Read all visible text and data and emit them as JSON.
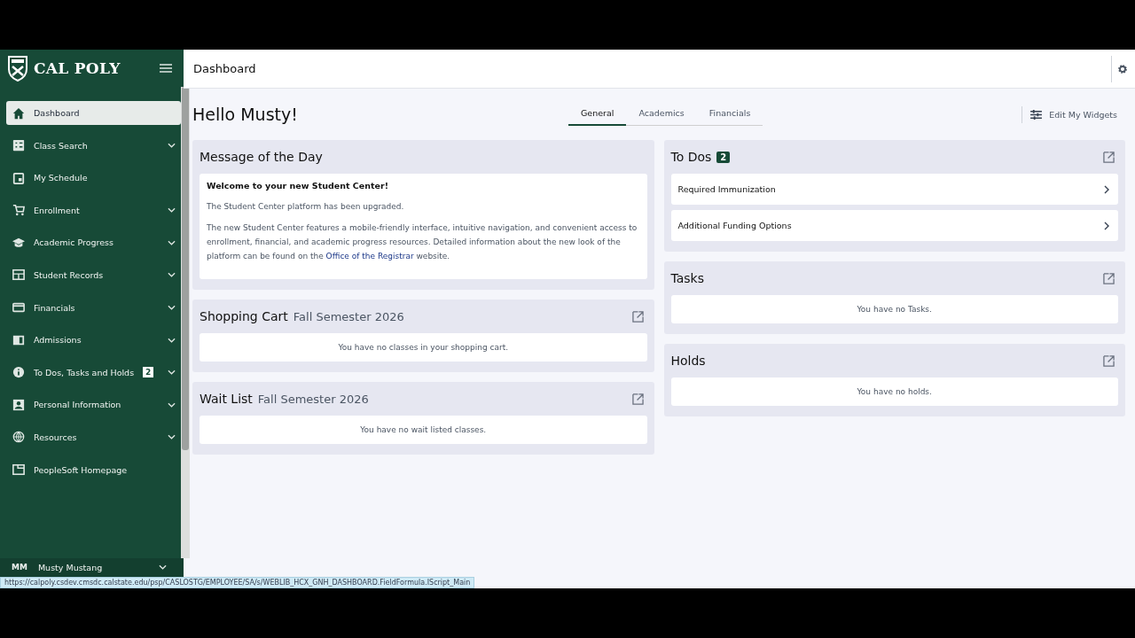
{
  "sidebar": {
    "logo": "CAL POLY",
    "items": [
      {
        "label": "Dashboard",
        "selected": true,
        "expandable": false
      },
      {
        "label": "Class Search",
        "selected": false,
        "expandable": true
      },
      {
        "label": "My Schedule",
        "selected": false,
        "expandable": false
      },
      {
        "label": "Enrollment",
        "selected": false,
        "expandable": true
      },
      {
        "label": "Academic Progress",
        "selected": false,
        "expandable": true
      },
      {
        "label": "Student Records",
        "selected": false,
        "expandable": true
      },
      {
        "label": "Financials",
        "selected": false,
        "expandable": true
      },
      {
        "label": "Admissions",
        "selected": false,
        "expandable": true
      },
      {
        "label": "To Dos, Tasks and Holds",
        "selected": false,
        "expandable": true,
        "badge": "2"
      },
      {
        "label": "Personal Information",
        "selected": false,
        "expandable": true
      },
      {
        "label": "Resources",
        "selected": false,
        "expandable": true
      },
      {
        "label": "PeopleSoft Homepage",
        "selected": false,
        "expandable": false
      }
    ],
    "user": {
      "initials": "MM",
      "name": "Musty Mustang"
    }
  },
  "header": {
    "title": "Dashboard"
  },
  "greeting": "Hello Musty!",
  "tabs": [
    {
      "label": "General",
      "selected": true
    },
    {
      "label": "Academics",
      "selected": false
    },
    {
      "label": "Financials",
      "selected": false
    }
  ],
  "edit_button": "Edit My Widgets",
  "message_of_the_day": {
    "title": "Message of the Day",
    "heading": "Welcome to your new Student Center!",
    "paragraph_1": "The Student Center platform has been upgraded.",
    "paragraph_2_before": "The new Student Center features a mobile-friendly interface, intuitive navigation, and convenient access to enrollment, financial, and academic progress resources. Detailed information about the new look of the platform can be found on the ",
    "paragraph_2_link": "Office of the Registrar",
    "paragraph_2_after": " website."
  },
  "shopping_cart": {
    "title": "Shopping Cart",
    "term": "Fall Semester 2026",
    "empty": "You have no classes in your shopping cart."
  },
  "wait_list": {
    "title": "Wait List",
    "term": "Fall Semester 2026",
    "empty": "You have no wait listed classes."
  },
  "to_dos": {
    "title": "To Dos",
    "count": "2",
    "items": [
      "Required Immunization",
      "Additional Funding Options"
    ]
  },
  "tasks": {
    "title": "Tasks",
    "empty": "You have no Tasks."
  },
  "holds": {
    "title": "Holds",
    "empty": "You have no holds."
  },
  "status_url": "https://calpoly.csdev.cmsdc.calstate.edu/psp/CASLOSTG/EMPLOYEE/SA/s/WEBLIB_HCX_GNH_DASHBOARD.FieldFormula.IScript_Main"
}
